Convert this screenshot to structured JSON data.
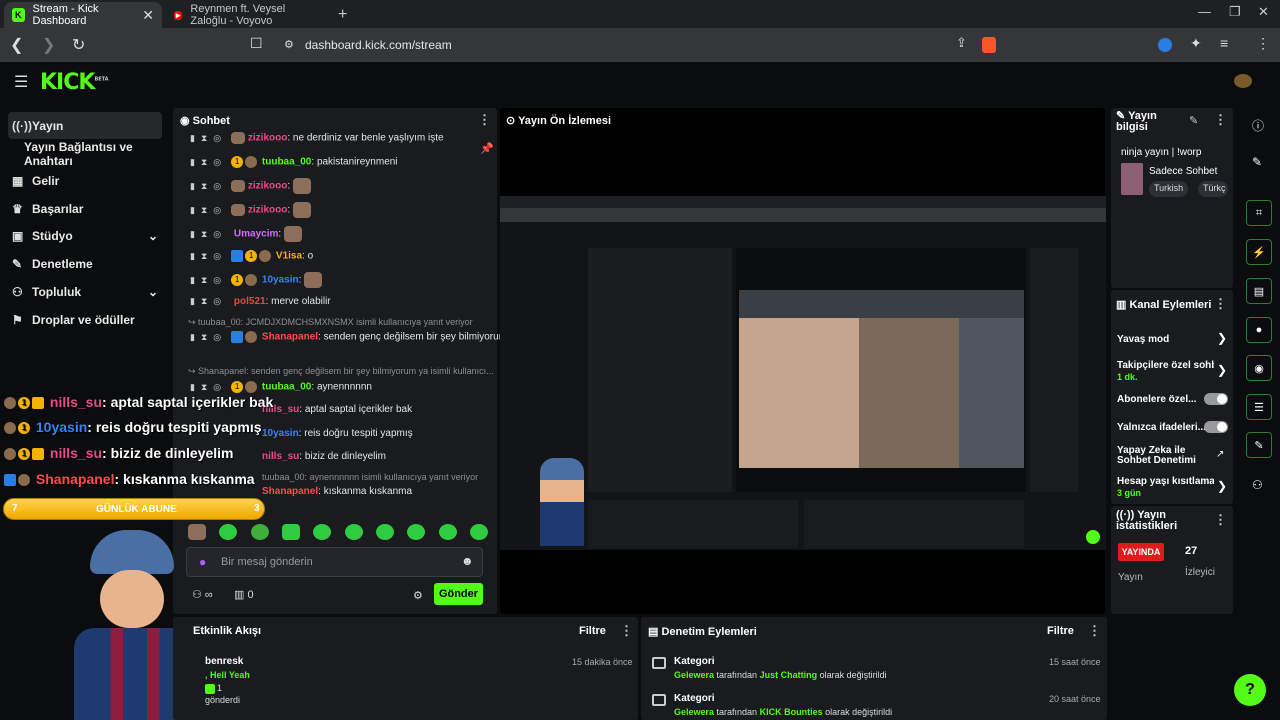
{
  "browser": {
    "tabs": [
      {
        "title": "Stream - Kick Dashboard"
      },
      {
        "title": "Reynmen ft. Veysel Zaloğlu - Voyovo"
      }
    ],
    "new_tab": "+",
    "url": "dashboard.kick.com/stream"
  },
  "kick": {
    "logo": "KICK",
    "logo_beta": "BETA"
  },
  "sidebar": {
    "items": [
      {
        "label": "Yayın",
        "icon": "broadcast-icon"
      },
      {
        "label": "Yayın Bağlantısı ve Anahtarı"
      },
      {
        "label": "Gelir",
        "icon": "chart-icon"
      },
      {
        "label": "Başarılar",
        "icon": "trophy-icon"
      },
      {
        "label": "Stüdyo",
        "icon": "studio-icon"
      },
      {
        "label": "Denetleme",
        "icon": "wrench-icon"
      },
      {
        "label": "Topluluk",
        "icon": "people-icon"
      },
      {
        "label": "Droplar ve ödüller",
        "icon": "gift-icon"
      }
    ]
  },
  "chat": {
    "title": "Sohbet",
    "messages": [
      {
        "user": "zizikooo",
        "color": "#e84c8a",
        "text": "ne derdiniz var benle yaşlıyım işte"
      },
      {
        "user": "tuubaa_00",
        "color": "#53fc18",
        "text": "pakistanireynmeni"
      },
      {
        "user": "zizikooo",
        "color": "#e84c8a",
        "text": ""
      },
      {
        "user": "zizikooo",
        "color": "#e84c8a",
        "text": ""
      },
      {
        "user": "Umaycim",
        "color": "#d36bff",
        "text": ""
      },
      {
        "user": "V1isa",
        "color": "#f5b301",
        "text": "o"
      },
      {
        "user": "10yasin",
        "color": "#3b82f6",
        "text": ""
      },
      {
        "user": "pol521",
        "color": "#e84c3d",
        "text": "merve olabilir"
      },
      {
        "user": "Shanapanel",
        "color": "#ff4d4d",
        "text": "senden genç değilsem bir şey bilmiyorum ya"
      },
      {
        "user": "tuubaa_00",
        "color": "#53fc18",
        "text": "aynennnnnn"
      },
      {
        "user": "nills_su",
        "color": "#e84c8a",
        "text": "aptal saptal içerikler bak"
      },
      {
        "user": "10yasin",
        "color": "#3b82f6",
        "text": "reis doğru tespiti yapmış"
      },
      {
        "user": "nills_su",
        "color": "#e84c8a",
        "text": "biziz de dinleyelim"
      },
      {
        "user": "Shanapanel",
        "color": "#ff4d4d",
        "text": "kıskanma kıskanma"
      }
    ],
    "reply1": "tuubaa_00: JCMDJXDMCHSMXNSMX isimli kullanıcıya yanıt veriyor",
    "reply2": "Shanapanel: senden genç değilsem bir şey bilmiyorum ya isimli kullanıcı...",
    "reply3": "tuubaa_00: aynennnnnn isimli kullanıcıya yanıt veriyor",
    "input_placeholder": "Bir mesaj gönderin",
    "send_label": "Gönder",
    "user_count": "0",
    "infinity": "∞"
  },
  "overlay": {
    "lines": [
      {
        "user": "nills_su",
        "color": "#e84c8a",
        "text": ": aptal saptal içerikler bak"
      },
      {
        "user": "10yasin",
        "color": "#3b82f6",
        "text": ": reis doğru tespiti yapmış"
      },
      {
        "user": "nills_su",
        "color": "#e84c8a",
        "text": ": biziz de dinleyelim"
      },
      {
        "user": "Shanapanel",
        "color": "#ff4d4d",
        "text": ": kıskanma kıskanma"
      }
    ],
    "goal_label": "GÜNLÜK ABUNE",
    "goal_left": "7",
    "goal_right": "3"
  },
  "preview": {
    "title": "Yayın Ön İzlemesi"
  },
  "stream_info": {
    "title": "Yayın bilgisi",
    "stream_name": "ninja yayın | !worp",
    "mode": "Sadece Sohbet",
    "tag1": "Turkish",
    "tag2": "Türkç"
  },
  "channel_actions": {
    "title": "Kanal Eylemleri",
    "slow": "Yavaş mod",
    "followers": "Takipçilere özel sohb",
    "followers_sub": "1 dk.",
    "subs": "Abonelere özel...",
    "emotes": "Yalnızca ifadeleri...",
    "ai_mod": "Yapay Zeka ile Sohbet Denetimi",
    "age": "Hesap yaşı kısıtlamas",
    "age_sub": "3 gün"
  },
  "stream_stats": {
    "title": "Yayın istatistikleri",
    "live_badge": "YAYINDA",
    "viewers": "27",
    "label_stream": "Yayın",
    "label_viewers": "İzleyici"
  },
  "activity": {
    "title": "Etkinlik Akışı",
    "filter": "Filtre",
    "item_user": "benresk",
    "item_msg": ", Hell Yeah",
    "item_count": "1",
    "item_action": "gönderdi",
    "item_time": "15 dakika önce"
  },
  "moderation": {
    "title": "Denetim Eylemleri",
    "filter": "Filtre",
    "items": [
      {
        "heading": "Kategori",
        "user": "Gelewera",
        "mid": " tarafından ",
        "target": "Just Chatting",
        "end": " olarak değiştirildi",
        "time": "15 saat önce"
      },
      {
        "heading": "Kategori",
        "user": "Gelewera",
        "mid": " tarafından ",
        "target": "KICK Bounties",
        "end": " olarak değiştirildi",
        "time": "20 saat önce"
      }
    ]
  },
  "colors": {
    "accent": "#53fc18",
    "panel": "#191b1f",
    "live": "#e01b1b"
  }
}
